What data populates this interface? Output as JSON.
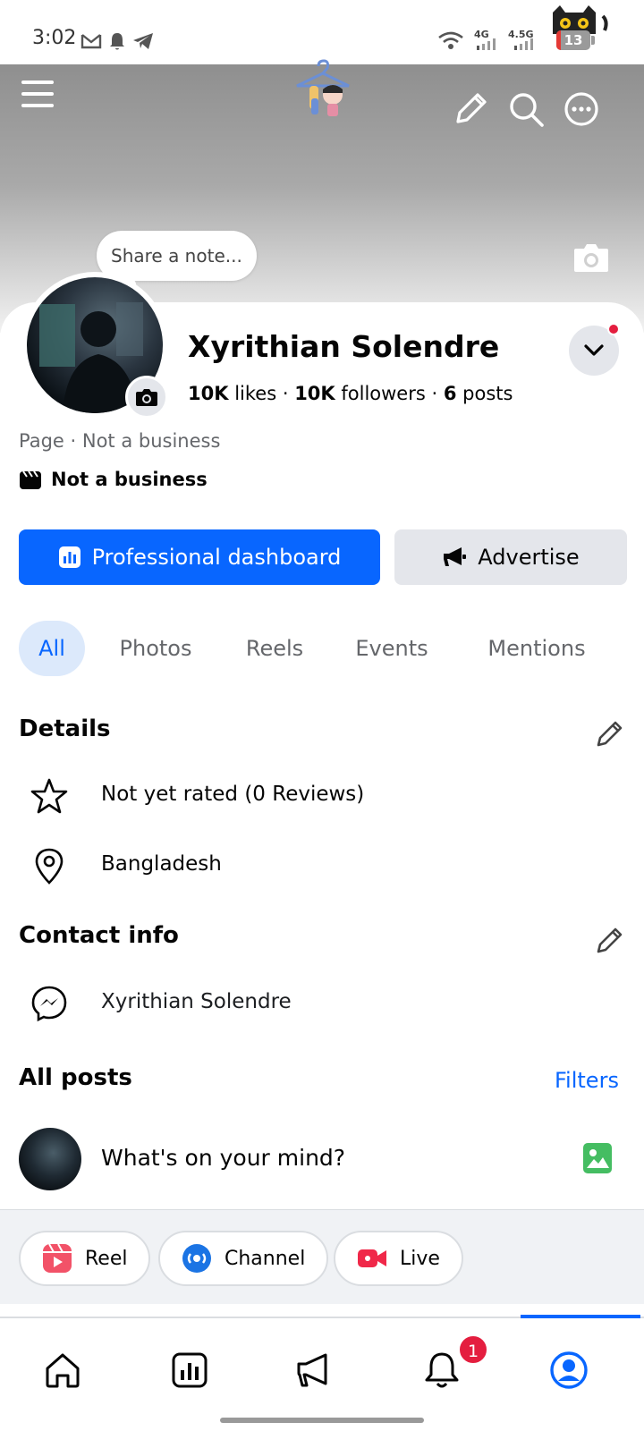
{
  "status_bar": {
    "time": "3:02",
    "network_1": "4G",
    "network_2": "4.5G",
    "battery_level": "13"
  },
  "header": {
    "note_prompt": "Share a note..."
  },
  "profile": {
    "name": "Xyrithian Solendre",
    "likes_count": "10K",
    "likes_label": "likes",
    "followers_count": "10K",
    "followers_label": "followers",
    "posts_count": "6",
    "posts_label": "posts",
    "category_line": "Page · Not a business",
    "business_label": "Not a business"
  },
  "actions": {
    "dashboard_label": "Professional dashboard",
    "advertise_label": "Advertise"
  },
  "tabs": [
    {
      "label": "All"
    },
    {
      "label": "Photos"
    },
    {
      "label": "Reels"
    },
    {
      "label": "Events"
    },
    {
      "label": "Mentions"
    }
  ],
  "details": {
    "title": "Details",
    "rating": "Not yet rated (0 Reviews)",
    "location": "Bangladesh"
  },
  "contact": {
    "title": "Contact info",
    "messenger": "Xyrithian Solendre"
  },
  "posts": {
    "title": "All posts",
    "filters_label": "Filters",
    "composer_placeholder": "What's on your mind?"
  },
  "chips": {
    "reel": "Reel",
    "channel": "Channel",
    "live": "Live"
  },
  "bottom_nav": {
    "notification_count": "1"
  },
  "colors": {
    "accent": "#0866ff",
    "secondary_button": "#e4e6eb",
    "badge": "#e41e3f",
    "photo_icon": "#45bd62"
  }
}
